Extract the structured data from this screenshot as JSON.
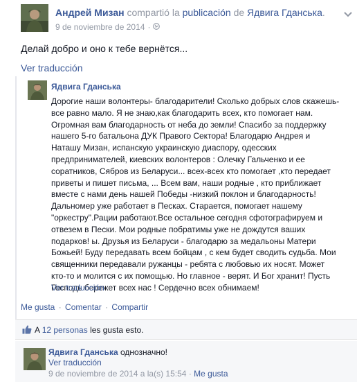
{
  "post": {
    "author": "Андрей Мизан",
    "action_prefix": "compartió la",
    "action_object": "publicación",
    "action_mid": "de",
    "shared_author": "Ядвига Гданська",
    "action_suffix": ".",
    "date": "9 de noviembre de 2014",
    "date_separator": "·",
    "text": "Делай добро и оно к тебе вернётся...",
    "see_translation": "Ver traducción"
  },
  "shared_post": {
    "author": "Ядвига Гданська",
    "lines": [
      "Дорогие наши волонтеры- благодарители! Сколько добрых слов скажешь-",
      "все равно мало. Я не знаю,как благодарить всех, кто помогает нам.",
      "Огромная вам благодарность от неба до земли! Спасибо за поддержку",
      "нашего 5-го батальона ДУК Правого Сектора! Благодарю Андрея и",
      "Наташу Мизан, испанскую украинскую диаспору, одесских",
      "предпринимателей, киевских волонтеров : Олечку Гальченко и ее",
      "соратников, Сябров из Беларуси... всех-всех кто помогает ,кто передает",
      "приветы и пишет письма, ... Всем вам, наши родные , кто приближает",
      "вместе с нами день нашей Победы -низкий поклон и благодарность!",
      "Дальномер уже работает в Песках. Старается, помогает нашему",
      "\"оркестру\".Рации работают.Все остальное сегодня сфотографируем и",
      "отвезем в Пески. Мои родные побратимы уже не дождутся ваших",
      "подарков! ы. Друзья из Беларуси - благодарю за медальоны Матери",
      "Божьей! Буду передавать всем бойцам , с кем будет сводить судьба. Мои",
      "священники передавали ружанцы - ребята с любовью их носят. Может",
      "кто-то и молится с их помощью. Но главное - верят. И Бог хранит! Пусть",
      "Господь бережет всех нас ! Сердечно всех обнимаем!"
    ],
    "see_translation": "Ver traducción"
  },
  "actions": {
    "like": "Me gusta",
    "separator": "·",
    "comment": "Comentar",
    "share": "Compartir"
  },
  "likes": {
    "prefix": "A",
    "people": "12 personas",
    "suffix": "les gusta esto."
  },
  "comment": {
    "author": "Ядвига Гданська",
    "text": "однозначно!",
    "see_translation": "Ver traducción",
    "timestamp": "9 de noviembre de 2014 a la(s) 15:54",
    "separator": "·",
    "like": "Me gusta"
  },
  "icons": {
    "privacy": "globe-icon",
    "menu": "chevron-down-icon",
    "like": "thumbs-up-icon"
  },
  "colors": {
    "link": "#3b5998",
    "muted": "#9197a3",
    "text": "#141823",
    "panel": "#f6f7f9"
  }
}
